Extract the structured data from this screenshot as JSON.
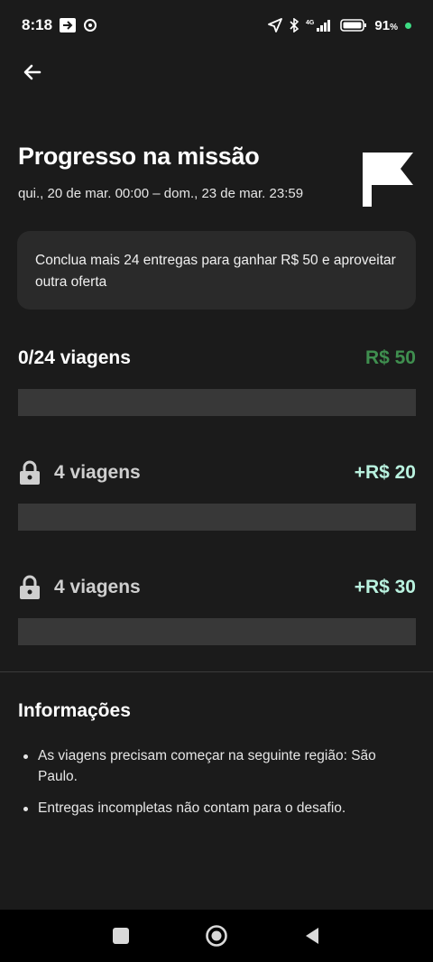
{
  "status_bar": {
    "time": "8:18",
    "network": "4G",
    "battery_percent": "91",
    "battery_unit": "%"
  },
  "header": {
    "title": "Progresso na missão",
    "date_range": "qui., 20 de mar. 00:00 – dom., 23 de mar. 23:59"
  },
  "info_card": {
    "text": "Conclua mais 24 entregas para ganhar R$ 50 e aproveitar outra oferta"
  },
  "tiers": [
    {
      "label": "0/24 viagens",
      "reward": "R$ 50",
      "locked": false,
      "progress": 0
    },
    {
      "label": "4 viagens",
      "reward": "+R$ 20",
      "locked": true,
      "progress": 0
    },
    {
      "label": "4 viagens",
      "reward": "+R$ 30",
      "locked": true,
      "progress": 0
    }
  ],
  "info_section": {
    "title": "Informações",
    "items": [
      "As viagens precisam começar na seguinte região: São Paulo.",
      "Entregas incompletas não contam para o desafio."
    ]
  },
  "colors": {
    "background": "#1b1b1b",
    "card": "#2a2a2a",
    "track": "#383838",
    "reward_green": "#3f8f4f",
    "bonus_mint": "#b9f2df"
  },
  "icons": {
    "back": "arrow-left-icon",
    "flag": "flag-icon",
    "lock": "lock-icon",
    "nav_recent": "square-icon",
    "nav_home": "circle-icon",
    "nav_back": "triangle-back-icon"
  }
}
